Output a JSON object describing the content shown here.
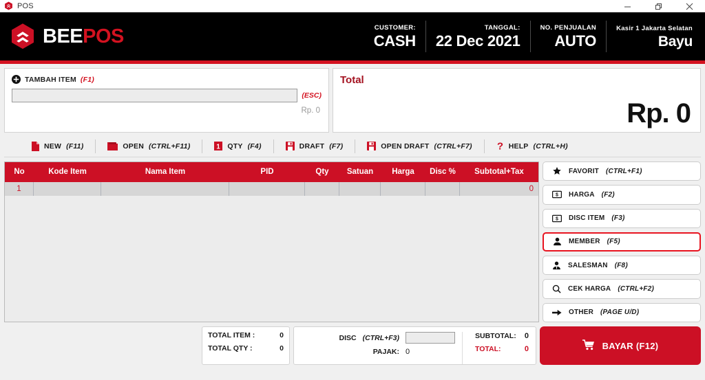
{
  "window": {
    "title": "POS",
    "app_icon": "beepos-logo-icon",
    "controls": [
      {
        "name": "minimize",
        "glyph": "minimize-icon"
      },
      {
        "name": "restore",
        "glyph": "restore-icon"
      },
      {
        "name": "close",
        "glyph": "close-icon"
      }
    ]
  },
  "header": {
    "brand_white": "BEE",
    "brand_red": "POS",
    "brand_icon": "beepos-hexagon-logo",
    "fields": [
      {
        "label": "CUSTOMER:",
        "value": "CASH"
      },
      {
        "label": "TANGGAL:",
        "value": "22 Dec 2021"
      },
      {
        "label": "NO. PENJUALAN",
        "value": "AUTO"
      },
      {
        "label": "Kasir 1 Jakarta Selatan",
        "value": "Bayu"
      }
    ]
  },
  "item_entry": {
    "add_icon": "plus-circle-icon",
    "add_label": "TAMBAH ITEM",
    "add_shortcut": "(F1)",
    "input_value": "",
    "input_placeholder": "",
    "esc_hint": "(ESC)",
    "price_hint": "Rp. 0"
  },
  "total_panel": {
    "label": "Total",
    "amount": "Rp. 0"
  },
  "toolbar": [
    {
      "icon": "file-icon",
      "label": "NEW",
      "shortcut": "(F11)"
    },
    {
      "icon": "folder-icon",
      "label": "OPEN",
      "shortcut": "(CTRL+F11)"
    },
    {
      "icon": "number-one-icon",
      "label": "QTY",
      "shortcut": "(F4)"
    },
    {
      "icon": "save-icon",
      "label": "DRAFT",
      "shortcut": "(F7)"
    },
    {
      "icon": "save-icon",
      "label": "OPEN DRAFT",
      "shortcut": "(CTRL+F7)"
    },
    {
      "icon": "question-mark-icon",
      "label": "HELP",
      "shortcut": "(CTRL+H)"
    }
  ],
  "grid": {
    "columns": [
      "No",
      "Kode Item",
      "Nama Item",
      "PID",
      "Qty",
      "Satuan",
      "Harga",
      "Disc %",
      "Subtotal+Tax"
    ],
    "rows": [
      {
        "no": "1",
        "kode": "",
        "nama": "",
        "pid": "",
        "qty": "",
        "satuan": "",
        "harga": "",
        "disc": "",
        "subtotal": "0"
      }
    ]
  },
  "side_buttons": [
    {
      "icon": "star-icon",
      "label": "FAVORIT",
      "shortcut": "(CTRL+F1)",
      "selected": false
    },
    {
      "icon": "banknote-icon",
      "label": "HARGA",
      "shortcut": "(F2)",
      "selected": false
    },
    {
      "icon": "banknote-icon",
      "label": "DISC ITEM",
      "shortcut": "(F3)",
      "selected": false
    },
    {
      "icon": "person-icon",
      "label": "MEMBER",
      "shortcut": "(F5)",
      "selected": true
    },
    {
      "icon": "person-tie-icon",
      "label": "SALESMAN",
      "shortcut": "(F8)",
      "selected": false
    },
    {
      "icon": "search-icon",
      "label": "CEK HARGA",
      "shortcut": "(CTRL+F2)",
      "selected": false
    },
    {
      "icon": "arrow-right-icon",
      "label": "OTHER",
      "shortcut": "(PAGE U/D)",
      "selected": false
    }
  ],
  "totals": {
    "total_item_label": "TOTAL ITEM :",
    "total_item_value": "0",
    "total_qty_label": "TOTAL QTY :",
    "total_qty_value": "0",
    "disc_label": "DISC",
    "disc_shortcut": "(CTRL+F3)",
    "disc_value": "",
    "pajak_label": "PAJAK:",
    "pajak_value": "0",
    "subtotal_label": "SUBTOTAL:",
    "subtotal_value": "0",
    "total_label": "TOTAL:",
    "total_value": "0"
  },
  "pay_button": {
    "icon": "cart-icon",
    "label": "BAYAR (F12)"
  },
  "colors": {
    "brand_red": "#cc1025",
    "accent_red": "#d31220",
    "header_black": "#000000",
    "page_bg": "#f0f0f0",
    "grid_row_bg": "#d6d6d6"
  }
}
